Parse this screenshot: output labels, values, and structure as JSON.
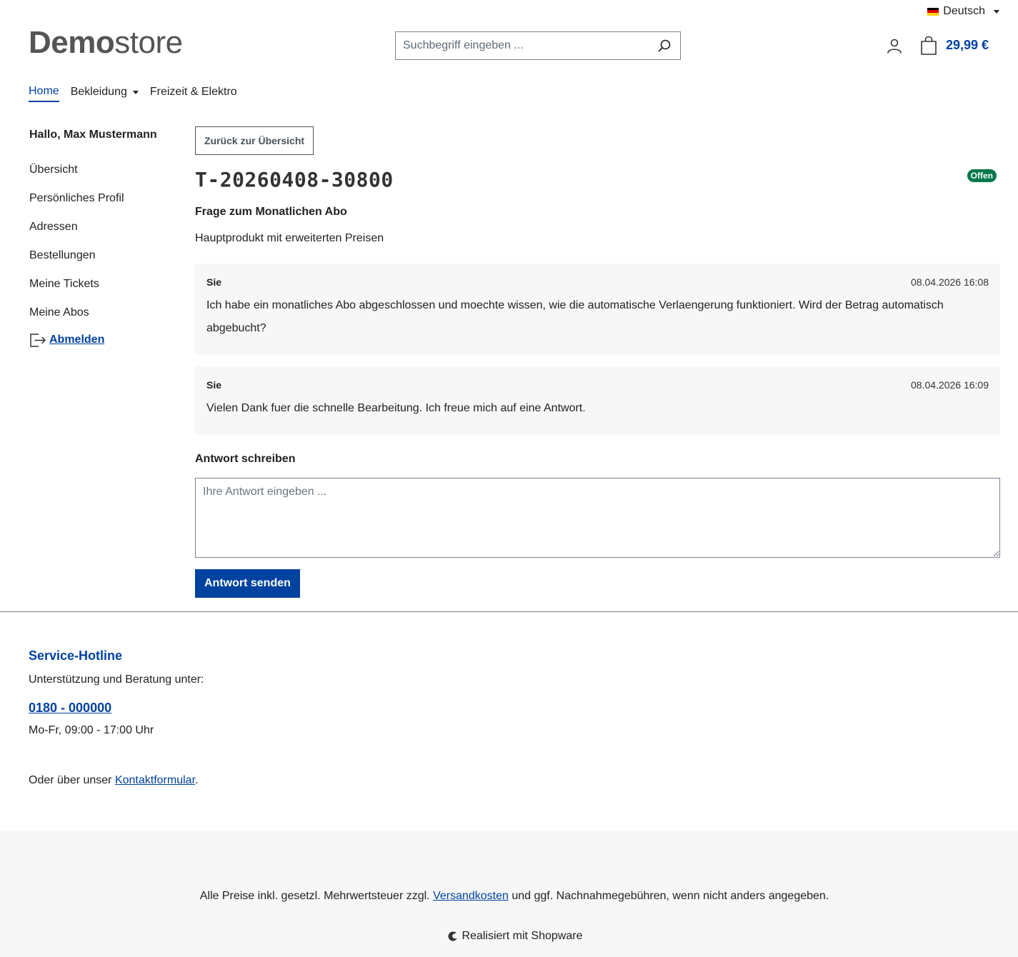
{
  "header": {
    "language": "Deutsch",
    "logo_bold": "Demo",
    "logo_light": "store",
    "search_placeholder": "Suchbegriff eingeben ...",
    "cart_total": "29,99 €"
  },
  "nav": {
    "items": [
      "Home",
      "Bekleidung",
      "Freizeit & Elektro"
    ]
  },
  "sidebar": {
    "greeting": "Hallo, Max Mustermann",
    "items": [
      "Übersicht",
      "Persönliches Profil",
      "Adressen",
      "Bestellungen",
      "Meine Tickets",
      "Meine Abos"
    ],
    "logout": "Abmelden"
  },
  "ticket": {
    "back_label": "Zurück zur Übersicht",
    "id": "T-20260408-30800",
    "status": "Offen",
    "subject": "Frage zum Monatlichen Abo",
    "product": "Hauptprodukt mit erweiterten Preisen",
    "messages": [
      {
        "author": "Sie",
        "date": "08.04.2026 16:08",
        "text": "Ich habe ein monatliches Abo abgeschlossen und moechte wissen, wie die automatische Verlaengerung funktioniert. Wird der Betrag automatisch abgebucht?"
      },
      {
        "author": "Sie",
        "date": "08.04.2026 16:09",
        "text": "Vielen Dank fuer die schnelle Bearbeitung. Ich freue mich auf eine Antwort."
      }
    ],
    "reply_label": "Antwort schreiben",
    "reply_placeholder": "Ihre Antwort eingeben ...",
    "send_label": "Antwort senden"
  },
  "footer": {
    "hotline_title": "Service-Hotline",
    "hotline_text": "Unterstützung und Beratung unter:",
    "phone": "0180 - 000000",
    "hours": "Mo-Fr, 09:00 - 17:00 Uhr",
    "contact_prefix": "Oder über unser ",
    "contact_link": "Kontaktformular",
    "contact_suffix": ".",
    "vat_prefix": "Alle Preise inkl. gesetzl. Mehrwertsteuer zzgl. ",
    "vat_link": "Versandkosten",
    "vat_suffix": " und ggf. Nachnahmegebühren, wenn nicht anders angegeben.",
    "powered": "Realisiert mit Shopware"
  },
  "colors": {
    "primary": "#0042a0",
    "success": "#00774a",
    "text": "#222222",
    "muted_bg": "#f7f7f7"
  }
}
